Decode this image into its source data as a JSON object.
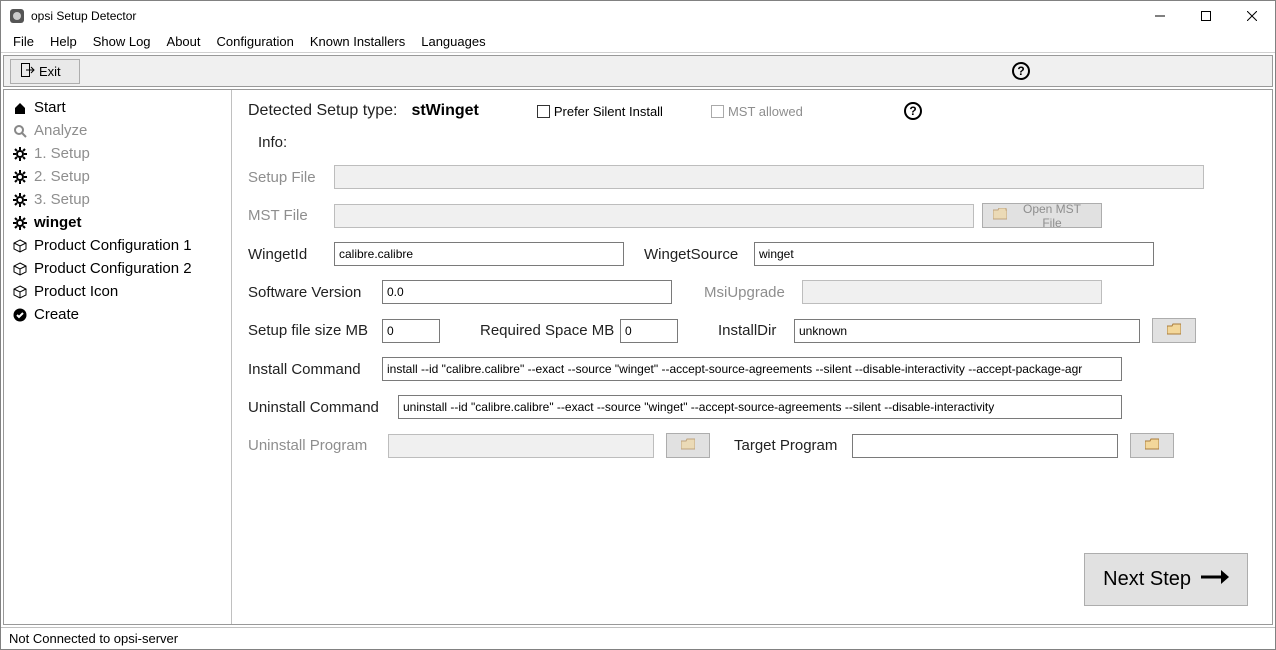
{
  "window": {
    "title": "opsi Setup Detector"
  },
  "menu": {
    "file": "File",
    "help": "Help",
    "showlog": "Show Log",
    "about": "About",
    "configuration": "Configuration",
    "known": "Known Installers",
    "languages": "Languages"
  },
  "toolbar": {
    "exit": "Exit"
  },
  "sidebar": {
    "items": [
      {
        "label": "Start"
      },
      {
        "label": "Analyze"
      },
      {
        "label": "1. Setup"
      },
      {
        "label": "2. Setup"
      },
      {
        "label": "3. Setup"
      },
      {
        "label": "winget"
      },
      {
        "label": "Product Configuration 1"
      },
      {
        "label": "Product Configuration 2"
      },
      {
        "label": "Product Icon"
      },
      {
        "label": "Create"
      }
    ]
  },
  "main": {
    "detected_label": "Detected Setup type:",
    "detected_value": "stWinget",
    "prefer_silent": "Prefer Silent Install",
    "mst_allowed": "MST allowed",
    "info": "Info:",
    "setup_file_label": "Setup File",
    "setup_file_value": "",
    "mst_file_label": "MST File",
    "mst_file_value": "",
    "open_mst_btn": "Open MST File",
    "wingetid_label": "WingetId",
    "wingetid_value": "calibre.calibre",
    "wingetsource_label": "WingetSource",
    "wingetsource_value": "winget",
    "swver_label": "Software Version",
    "swver_value": "0.0",
    "msiupgrade_label": "MsiUpgrade",
    "msiupgrade_value": "",
    "sfsize_label": "Setup file size MB",
    "sfsize_value": "0",
    "reqspace_label": "Required Space MB",
    "reqspace_value": "0",
    "installdir_label": "InstallDir",
    "installdir_value": "unknown",
    "installcmd_label": "Install Command",
    "installcmd_value": "install --id \"calibre.calibre\" --exact --source \"winget\" --accept-source-agreements --silent --disable-interactivity --accept-package-agr",
    "uninstallcmd_label": "Uninstall Command",
    "uninstallcmd_value": "uninstall --id \"calibre.calibre\" --exact --source \"winget\" --accept-source-agreements --silent --disable-interactivity",
    "uninstallprog_label": "Uninstall Program",
    "uninstallprog_value": "",
    "targetprog_label": "Target Program",
    "targetprog_value": "",
    "next_step": "Next Step"
  },
  "status": {
    "text": "Not Connected to opsi-server"
  }
}
